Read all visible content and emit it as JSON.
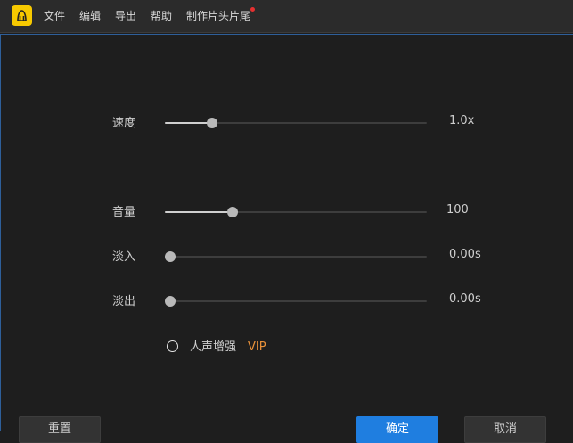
{
  "menu": {
    "items": [
      {
        "label": "文件"
      },
      {
        "label": "编辑"
      },
      {
        "label": "导出"
      },
      {
        "label": "帮助"
      },
      {
        "label": "制作片头片尾"
      }
    ]
  },
  "settings": {
    "speed": {
      "label": "速度",
      "value": "1.0x",
      "level": 0.18
    },
    "volume": {
      "label": "音量",
      "value": "100",
      "level": 0.26
    },
    "fade_in": {
      "label": "淡入",
      "value": "0.00s",
      "level": 0.0
    },
    "fade_out": {
      "label": "淡出",
      "value": "0.00s",
      "level": 0.0
    }
  },
  "voice_enhance": {
    "label": "人声增强",
    "badge": "VIP",
    "checked": false
  },
  "buttons": {
    "reset": "重置",
    "ok": "确定",
    "cancel": "取消"
  },
  "colors": {
    "accent": "#1f7ee0",
    "vip": "#e8913a",
    "logo": "#f7c900",
    "notification_dot": "#e53030"
  }
}
